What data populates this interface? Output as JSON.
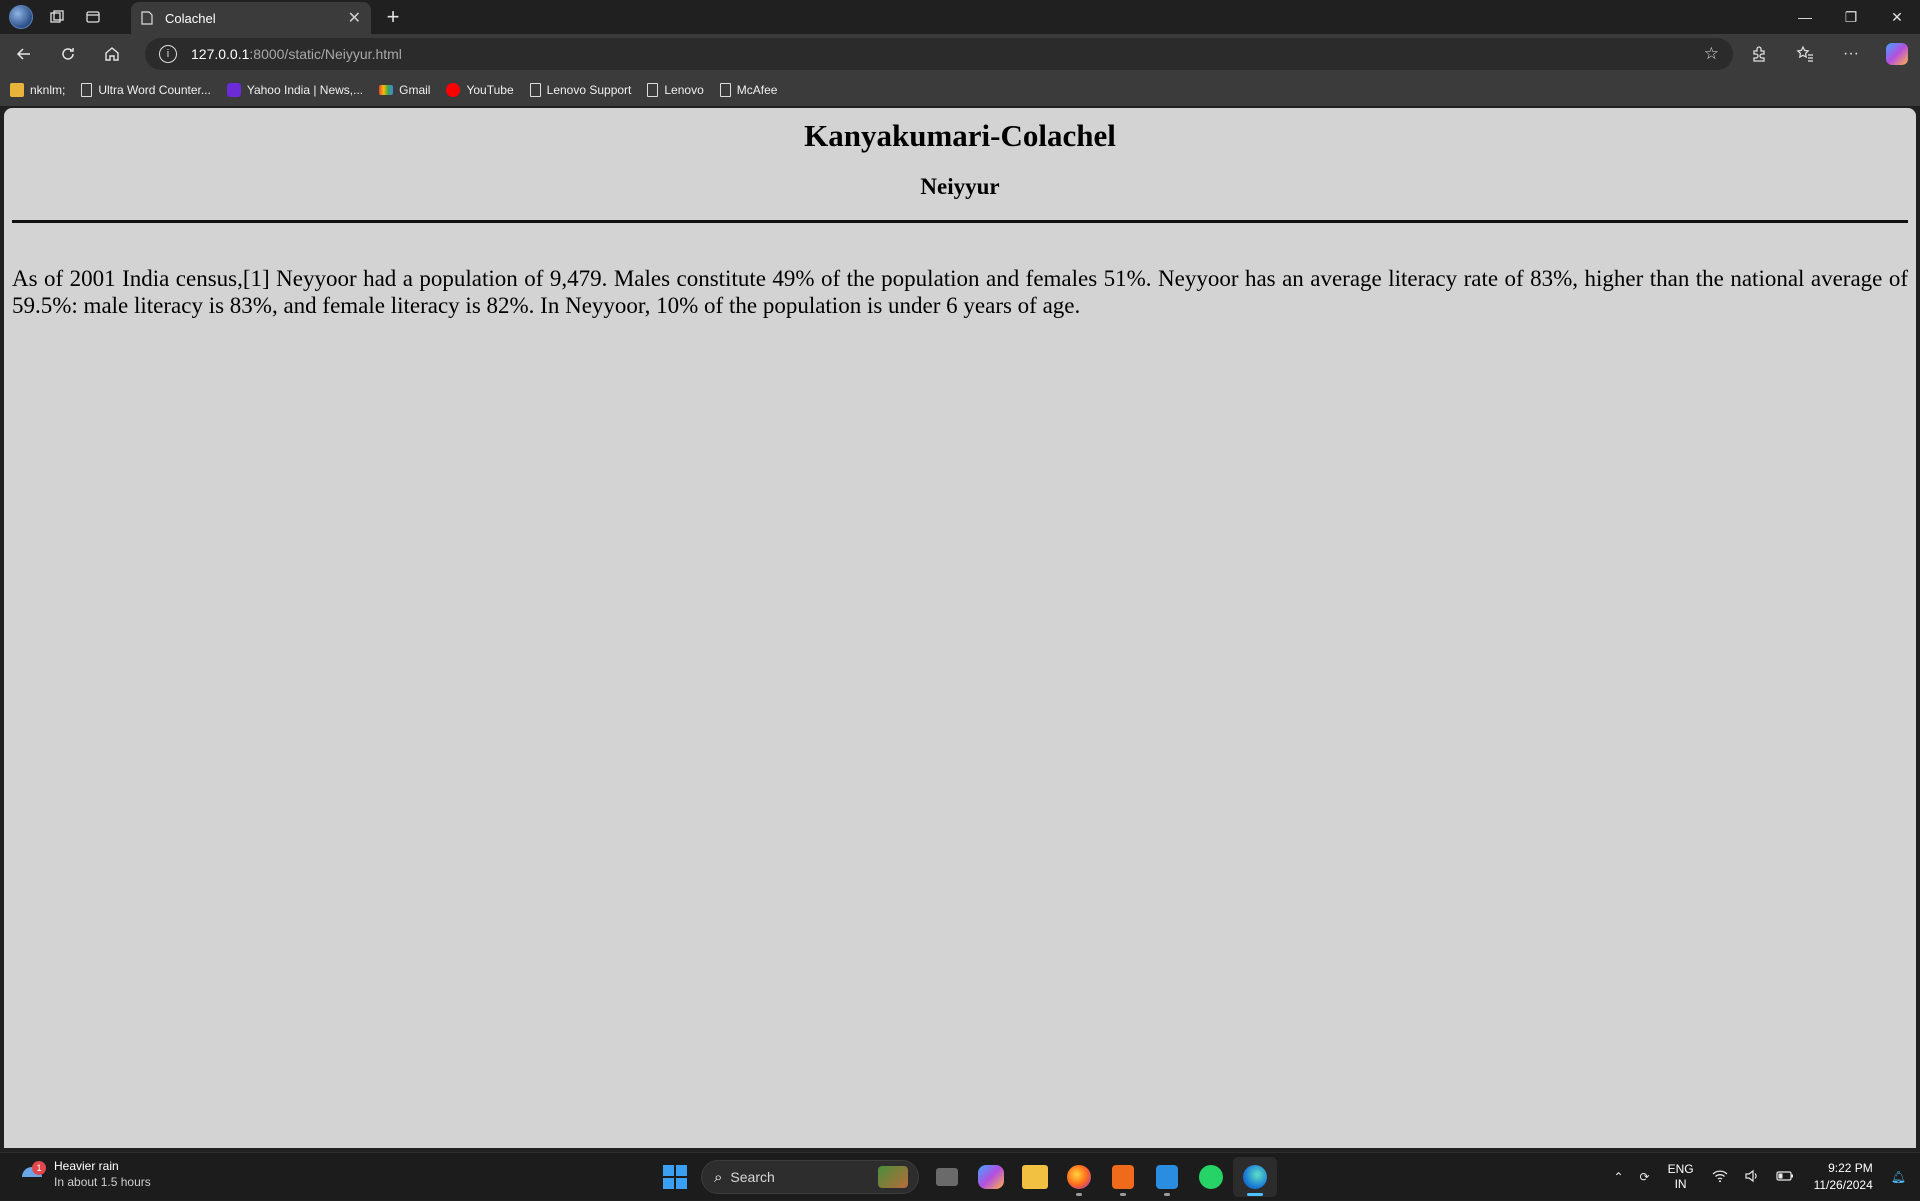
{
  "browser": {
    "tab": {
      "title": "Colachel"
    },
    "address": {
      "host": "127.0.0.1",
      "path": ":8000/static/Neiyyur.html"
    },
    "bookmarks": [
      {
        "label": "nknlm;",
        "icon": "folder-icon"
      },
      {
        "label": "Ultra Word Counter...",
        "icon": "page-icon"
      },
      {
        "label": "Yahoo India | News,...",
        "icon": "yahoo-icon"
      },
      {
        "label": "Gmail",
        "icon": "gmail-icon"
      },
      {
        "label": "YouTube",
        "icon": "youtube-icon"
      },
      {
        "label": "Lenovo Support",
        "icon": "page-icon"
      },
      {
        "label": "Lenovo",
        "icon": "page-icon"
      },
      {
        "label": "McAfee",
        "icon": "page-icon"
      }
    ]
  },
  "page": {
    "heading": "Kanyakumari-Colachel",
    "subheading": "Neiyyur",
    "paragraph": "As of 2001 India census,[1] Neyyoor had a population of 9,479. Males constitute 49% of the population and females 51%. Neyyoor has an average literacy rate of 83%, higher than the national average of 59.5%: male literacy is 83%, and female literacy is 82%. In Neyyoor, 10% of the population is under 6 years of age."
  },
  "taskbar": {
    "weather": {
      "title": "Heavier rain",
      "subtitle": "In about 1.5 hours",
      "badge": "1"
    },
    "search_label": "Search",
    "tray": {
      "lang_top": "ENG",
      "lang_bottom": "IN",
      "time": "9:22 PM",
      "date": "11/26/2024"
    }
  },
  "colors": {
    "page_background": "#d3d3d3",
    "browser_chrome": "#3b3b3b",
    "accent": "#4cc2ff"
  }
}
